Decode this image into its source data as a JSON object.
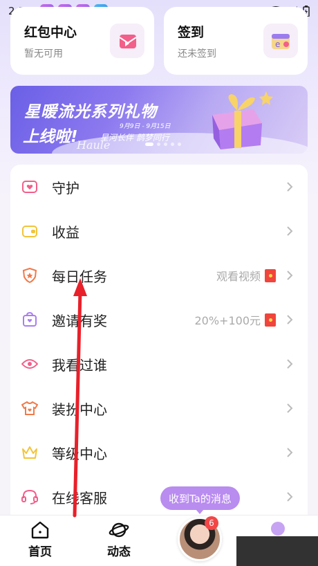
{
  "status_bar": {
    "time": "2:59",
    "notif_icons": [
      "app-notification-icon",
      "app-notification-icon",
      "app-notification-icon",
      "cloud-app-icon"
    ],
    "right_icons": [
      "wifi-icon",
      "signal-icon",
      "battery-icon"
    ]
  },
  "top_cards": [
    {
      "title": "红包中心",
      "subtitle": "暂无可用",
      "icon": "red-envelope-icon"
    },
    {
      "title": "签到",
      "subtitle": "还未签到",
      "icon": "calendar-checkin-icon"
    }
  ],
  "banner": {
    "line1": "星暖流光系列礼物",
    "line2": "上线啦!",
    "date": "9月9日 - 9月15日",
    "tagline": "星河长伴  鹊梦同行",
    "signature": "Haule",
    "icon": "gift-box-icon"
  },
  "menu": [
    {
      "label": "守护",
      "icon": "heart-tv-icon",
      "hint": ""
    },
    {
      "label": "收益",
      "icon": "wallet-icon",
      "hint": ""
    },
    {
      "label": "每日任务",
      "icon": "shield-task-icon",
      "hint": "观看视频"
    },
    {
      "label": "邀请有奖",
      "icon": "gift-bag-icon",
      "hint": "20%+100元"
    },
    {
      "label": "我看过谁",
      "icon": "eye-icon",
      "hint": ""
    },
    {
      "label": "装扮中心",
      "icon": "tshirt-icon",
      "hint": ""
    },
    {
      "label": "等级中心",
      "icon": "crown-icon",
      "hint": ""
    },
    {
      "label": "在线客服",
      "icon": "headset-icon",
      "hint": ""
    }
  ],
  "tooltip": "收到Ta的消息",
  "bottom_nav": {
    "home": "首页",
    "feed": "动态",
    "badge_count": "6"
  },
  "colors": {
    "accent_purple": "#b98cf0",
    "red_packet": "#f0453c",
    "annotation_arrow": "#e8202a"
  }
}
